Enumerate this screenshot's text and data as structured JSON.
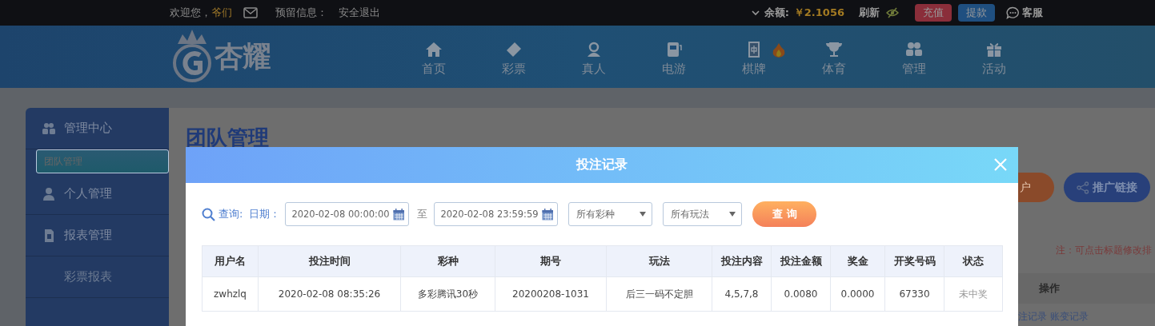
{
  "top_bar": {
    "greeting": "欢迎您，",
    "username": "爷们",
    "reserved_label": "预留信息：",
    "logout": "安全退出",
    "balance_label": "余额:",
    "balance": "￥2.1056",
    "refresh": "刷新",
    "recharge": "充值",
    "withdraw": "提款",
    "service": "客服"
  },
  "header": {
    "logo_text": "杏耀",
    "nav": [
      {
        "label": "首页",
        "hot": false
      },
      {
        "label": "彩票",
        "hot": false
      },
      {
        "label": "真人",
        "hot": false
      },
      {
        "label": "电游",
        "hot": false
      },
      {
        "label": "棋牌",
        "hot": true
      },
      {
        "label": "体育",
        "hot": false
      },
      {
        "label": "管理",
        "hot": false
      },
      {
        "label": "活动",
        "hot": false
      }
    ]
  },
  "sidebar": {
    "groups": [
      {
        "label": "管理中心",
        "children": [
          {
            "label": "团队管理",
            "selected": true
          }
        ]
      },
      {
        "label": "个人管理"
      },
      {
        "label": "报表管理",
        "children": [
          {
            "label": "彩票报表",
            "selected": false
          }
        ]
      }
    ]
  },
  "content": {
    "title": "团队管理",
    "open_account_button": "户",
    "promo_button": "推广链接",
    "note": "注：可点击标题修改排",
    "action_header": "操作",
    "links": [
      "注记录",
      "账变记录"
    ]
  },
  "modal": {
    "title": "投注记录",
    "query_label": "查询:",
    "date_label": "日期：",
    "start_date": "2020-02-08 00:00:00",
    "to_label": "至",
    "end_date": "2020-02-08 23:59:59",
    "lottery_select": "所有彩种",
    "play_select": "所有玩法",
    "query_button": "查 询",
    "table": {
      "columns": [
        "用户名",
        "投注时间",
        "彩种",
        "期号",
        "玩法",
        "投注内容",
        "投注金额",
        "奖金",
        "开奖号码",
        "状态"
      ],
      "rows": [
        {
          "cells": [
            "zwhzlq",
            "2020-02-08 08:35:26",
            "多彩腾讯30秒",
            "20200208-1031",
            "后三一码不定胆",
            "4,5,7,8",
            "0.0080",
            "0.0000",
            "67330",
            "未中奖"
          ]
        }
      ]
    }
  }
}
